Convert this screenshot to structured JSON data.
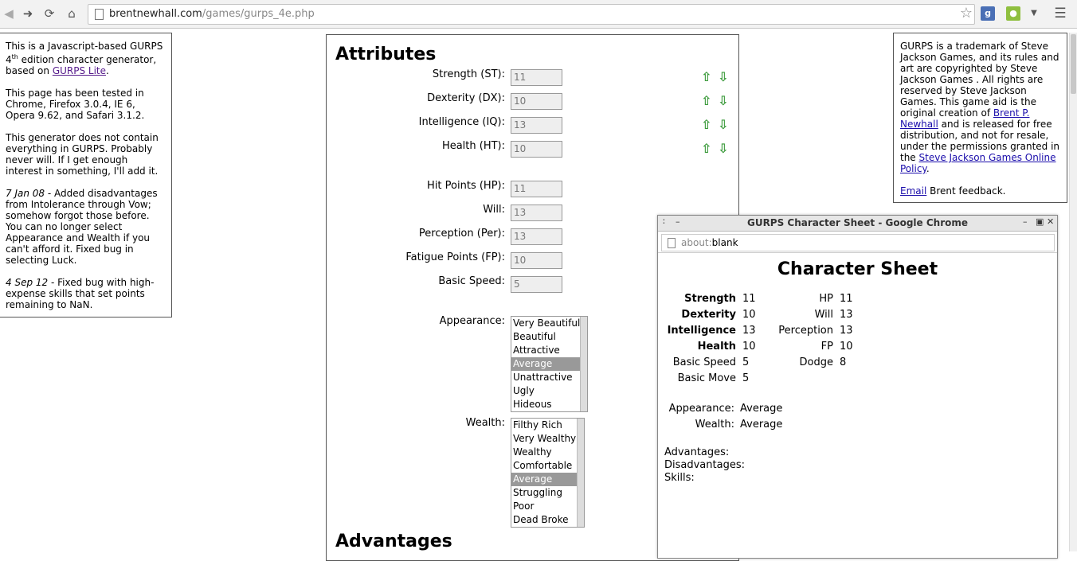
{
  "browser": {
    "url_domain": "brentnewhall.com",
    "url_path": "/games/gurps_4e.php",
    "icons": [
      "back-icon",
      "forward-icon",
      "reload-icon",
      "home-icon",
      "bookmark-star-icon",
      "google-extension-icon",
      "chat-extension-icon",
      "menu-icon"
    ]
  },
  "left": {
    "p1_a": "This is a Javascript-based GURPS 4",
    "p1_sup": "th",
    "p1_b": " edition character generator, based on ",
    "p1_link": "GURPS Lite",
    "p1_c": ".",
    "p2": "This page has been tested in Chrome, Firefox 3.0.4, IE 6, Opera 9.62, and Safari 3.1.2.",
    "p3": "This generator does not contain everything in GURPS. Probably never will. If I get enough interest in something, I'll add it.",
    "p4_date": "7 Jan 08",
    "p4": " - Added disadvantages from Intolerance through Vow; somehow forgot those before. You can no longer select Appearance and Wealth if you can't afford it. Fixed bug in selecting Luck.",
    "p5_date": "4 Sep 12",
    "p5": " - Fixed bug with high-expense skills that set points remaining to NaN."
  },
  "right": {
    "p1_a": "GURPS is a trademark of Steve Jackson Games, and its rules and art are copyrighted by Steve Jackson Games . All rights are reserved by Steve Jackson Games. This game aid is the original creation of ",
    "p1_link1": "Brent P. Newhall",
    "p1_b": " and is released for free distribution, and not for resale, under the permissions granted in the ",
    "p1_link2": "Steve Jackson Games Online Policy",
    "p1_c": ".",
    "p2_link": "Email",
    "p2": " Brent feedback."
  },
  "main": {
    "attributes_heading": "Attributes",
    "advantages_heading": "Advantages",
    "attributes": [
      {
        "label": "Strength (ST):",
        "value": "11"
      },
      {
        "label": "Dexterity (DX):",
        "value": "10"
      },
      {
        "label": "Intelligence (IQ):",
        "value": "13"
      },
      {
        "label": "Health (HT):",
        "value": "10"
      }
    ],
    "secondary": [
      {
        "label": "Hit Points (HP):",
        "value": "11"
      },
      {
        "label": "Will:",
        "value": "13"
      },
      {
        "label": "Perception (Per):",
        "value": "13"
      },
      {
        "label": "Fatigue Points (FP):",
        "value": "10"
      },
      {
        "label": "Basic Speed:",
        "value": "5"
      }
    ],
    "appearance_label": "Appearance:",
    "appearance_options": [
      "Very Beautiful",
      "Beautiful",
      "Attractive",
      "Average",
      "Unattractive",
      "Ugly",
      "Hideous"
    ],
    "appearance_selected": "Average",
    "wealth_label": "Wealth:",
    "wealth_options": [
      "Filthy Rich",
      "Very Wealthy",
      "Wealthy",
      "Comfortable",
      "Average",
      "Struggling",
      "Poor",
      "Dead Broke"
    ],
    "wealth_selected": "Average"
  },
  "popup": {
    "window_title": "GURPS Character Sheet - Google Chrome",
    "addr_scheme": "about:",
    "addr_rest": "blank",
    "heading": "Character Sheet",
    "left_stats": [
      {
        "label": "Strength",
        "value": "11",
        "bold": true
      },
      {
        "label": "Dexterity",
        "value": "10",
        "bold": true
      },
      {
        "label": "Intelligence",
        "value": "13",
        "bold": true
      },
      {
        "label": "Health",
        "value": "10",
        "bold": true
      },
      {
        "label": "Basic Speed",
        "value": "5",
        "bold": false
      },
      {
        "label": "Basic Move",
        "value": "5",
        "bold": false
      }
    ],
    "right_stats": [
      {
        "label": "HP",
        "value": "11"
      },
      {
        "label": "Will",
        "value": "13"
      },
      {
        "label": "Perception",
        "value": "13"
      },
      {
        "label": "FP",
        "value": "10"
      },
      {
        "label": "Dodge",
        "value": "8"
      }
    ],
    "appearance_label": "Appearance:",
    "appearance_value": "Average",
    "wealth_label": "Wealth:",
    "wealth_value": "Average",
    "advantages_label": "Advantages:",
    "disadvantages_label": "Disadvantages:",
    "skills_label": "Skills:"
  }
}
